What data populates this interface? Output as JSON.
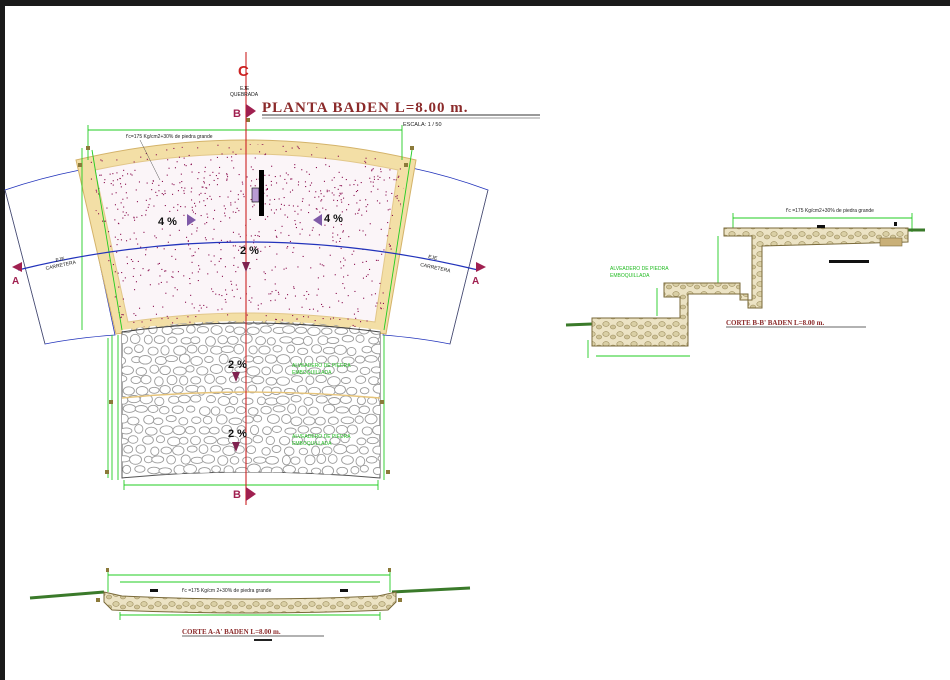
{
  "plan": {
    "title": "PLANTA BADEN L=8.00 m.",
    "scale": "ESCALA: 1 / 50",
    "axis_letter": "C",
    "axis_label_1": "EJE",
    "axis_label_2": "QUEBRADA",
    "road_axis_label_1": "EJE",
    "road_axis_label_2": "CARRETERA",
    "concrete_note": "f'c=175 Kg/cm2+30% de piedra grande",
    "slope_left": "4 %",
    "slope_right": "4 %",
    "slope_center": "2 %",
    "slope_lower_1": "2 %",
    "slope_lower_2": "2 %",
    "masonry_note_1a": "ALVEADERO DE PIEDRA",
    "masonry_note_1b": "EMBOQUILLADA",
    "masonry_note_2a": "ALVEADERO DE PIEDRA",
    "masonry_note_2b": "EMBOQUILLADA",
    "cut_top": "B",
    "cut_bottom": "B",
    "cut_left": "A",
    "cut_right": "A"
  },
  "section_bb": {
    "title": "CORTE B-B'  BADEN L=8.00 m.",
    "concrete_note": "f'c =175 Kg/cm2+30% de piedra grande",
    "masonry_note_a": "ALVEADERO DE PIEDRA",
    "masonry_note_b": "EMBOQUILLADA"
  },
  "section_aa": {
    "title": "CORTE A-A'  BADEN L=8.00 m.",
    "concrete_note": "f'c =175 Kg/cm 2+30% de piedra grande"
  },
  "colors": {
    "background": "#ffffff",
    "frame": "#1a1a1a",
    "axis": "#cc2222",
    "road_axis": "#2233bb",
    "dimension": "#22cc22",
    "slab_border": "#f3dfa6",
    "speckle": "#8a1050",
    "title": "#8b2a2a",
    "stone": "#9c9c9c"
  }
}
